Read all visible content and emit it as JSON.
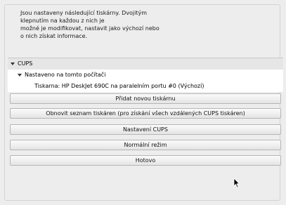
{
  "intro": {
    "lines": [
      "Jsou nastaveny následující tiskárny. Dvojitým",
      "klepnutím na každou z nich je",
      "možné je modifikovat, nastavit jako výchozí nebo",
      "o nich získat informace."
    ]
  },
  "tree": {
    "group": "CUPS",
    "subgroup": "Nastaveno na tomto počítači",
    "printer": "Tiskarna: HP DeskJet 690C na paralelním portu #0 (Výchozí)"
  },
  "buttons": {
    "add_printer": "Přidat novou tiskárnu",
    "refresh": "Obnovit seznam tiskáren (pro získání všech vzdálených CUPS tiskáren)",
    "cups_settings": "Nastavení CUPS",
    "normal_mode": "Normální režim",
    "done": "Hotovo"
  },
  "icons": {
    "expand": "triangle-down-icon",
    "cursor": "mouse-pointer-icon"
  }
}
